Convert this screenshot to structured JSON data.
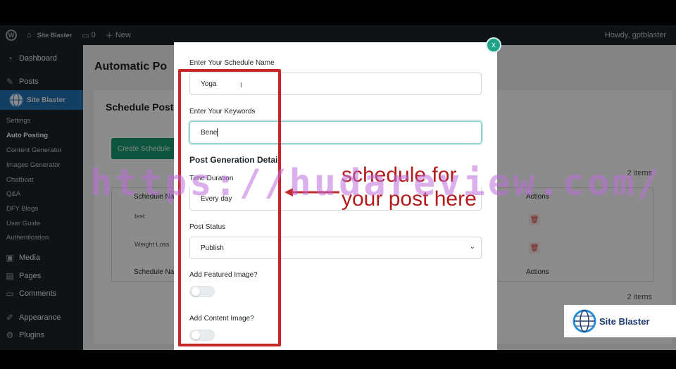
{
  "adminbar": {
    "site_name": "Site Blaster",
    "comments_count": "0",
    "new_label": "New",
    "howdy": "Howdy, gptblaster"
  },
  "sidebar": {
    "dashboard": "Dashboard",
    "posts": "Posts",
    "active": "Site Blaster",
    "subitems": [
      "Settings",
      "Auto Posting",
      "Content Generator",
      "Images Generator",
      "Chatboat",
      "Q&A",
      "DFY Blogs",
      "User Guide",
      "Authentication"
    ],
    "media": "Media",
    "pages": "Pages",
    "comments": "Comments",
    "appearance": "Appearance",
    "plugins": "Plugins"
  },
  "page": {
    "title": "Automatic Po",
    "card_title": "Schedule Post",
    "create_button": "Create Schedule",
    "items_count_top": "2 items",
    "items_count_bottom": "2 items",
    "table": {
      "col_name": "Schedule Na",
      "col_actions": "Actions",
      "rows": [
        {
          "name": "test"
        },
        {
          "name": "Weight Loss"
        }
      ],
      "footer_name": "Schedule Na",
      "footer_actions": "Actions"
    }
  },
  "modal": {
    "close_label": "x",
    "schedule_name_label": "Enter Your Schedule Name",
    "schedule_name_value": "Yoga",
    "keywords_label": "Enter Your Keywords",
    "keywords_value": "Bene",
    "section_title": "Post Generation Detail",
    "time_duration_label": "Time Duration",
    "time_duration_value": "Every day",
    "post_status_label": "Post Status",
    "post_status_value": "Publish",
    "featured_image_label": "Add Featured Image?",
    "content_image_label": "Add Content Image?"
  },
  "annotation": {
    "line1": "schedule for",
    "line2": "your post here",
    "color": "#c62828"
  },
  "watermark": "https://hudareview.com/",
  "logo": {
    "text": "Site Blaster"
  },
  "colors": {
    "accent": "#1fa388",
    "wp_blue": "#2271b1",
    "admin_dark": "#1d2327",
    "danger": "#d63638"
  }
}
